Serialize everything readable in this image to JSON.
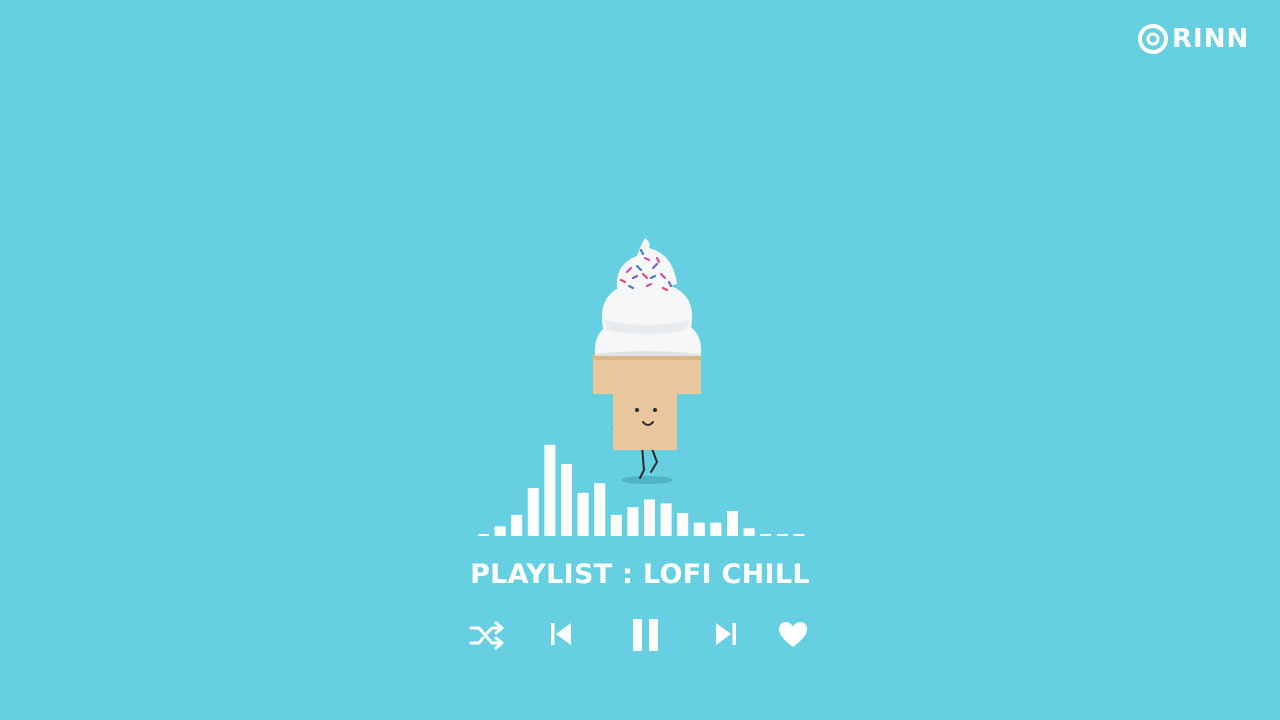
{
  "brand": {
    "logo_icon": "disc-icon",
    "logo_text": "RINN"
  },
  "player": {
    "playlist_label": "PLAYLIST : LOFI CHILL",
    "controls": {
      "shuffle_icon": "shuffle-icon",
      "previous_icon": "skip-previous-icon",
      "pause_icon": "pause-icon",
      "next_icon": "skip-next-icon",
      "like_icon": "heart-icon"
    }
  },
  "visualizer": {
    "levels": [
      0.02,
      0.1,
      0.22,
      0.5,
      0.95,
      0.75,
      0.45,
      0.55,
      0.22,
      0.3,
      0.38,
      0.34,
      0.24,
      0.14,
      0.14,
      0.26,
      0.08,
      0.02,
      0.02,
      0.02
    ]
  },
  "colors": {
    "background": "#66cfe2",
    "foreground": "#ffffff",
    "cone": "#e7c79b",
    "cone_shadow": "#d9b684",
    "cream": "#f6f7f8",
    "cream_shadow": "#dfe3e6"
  }
}
